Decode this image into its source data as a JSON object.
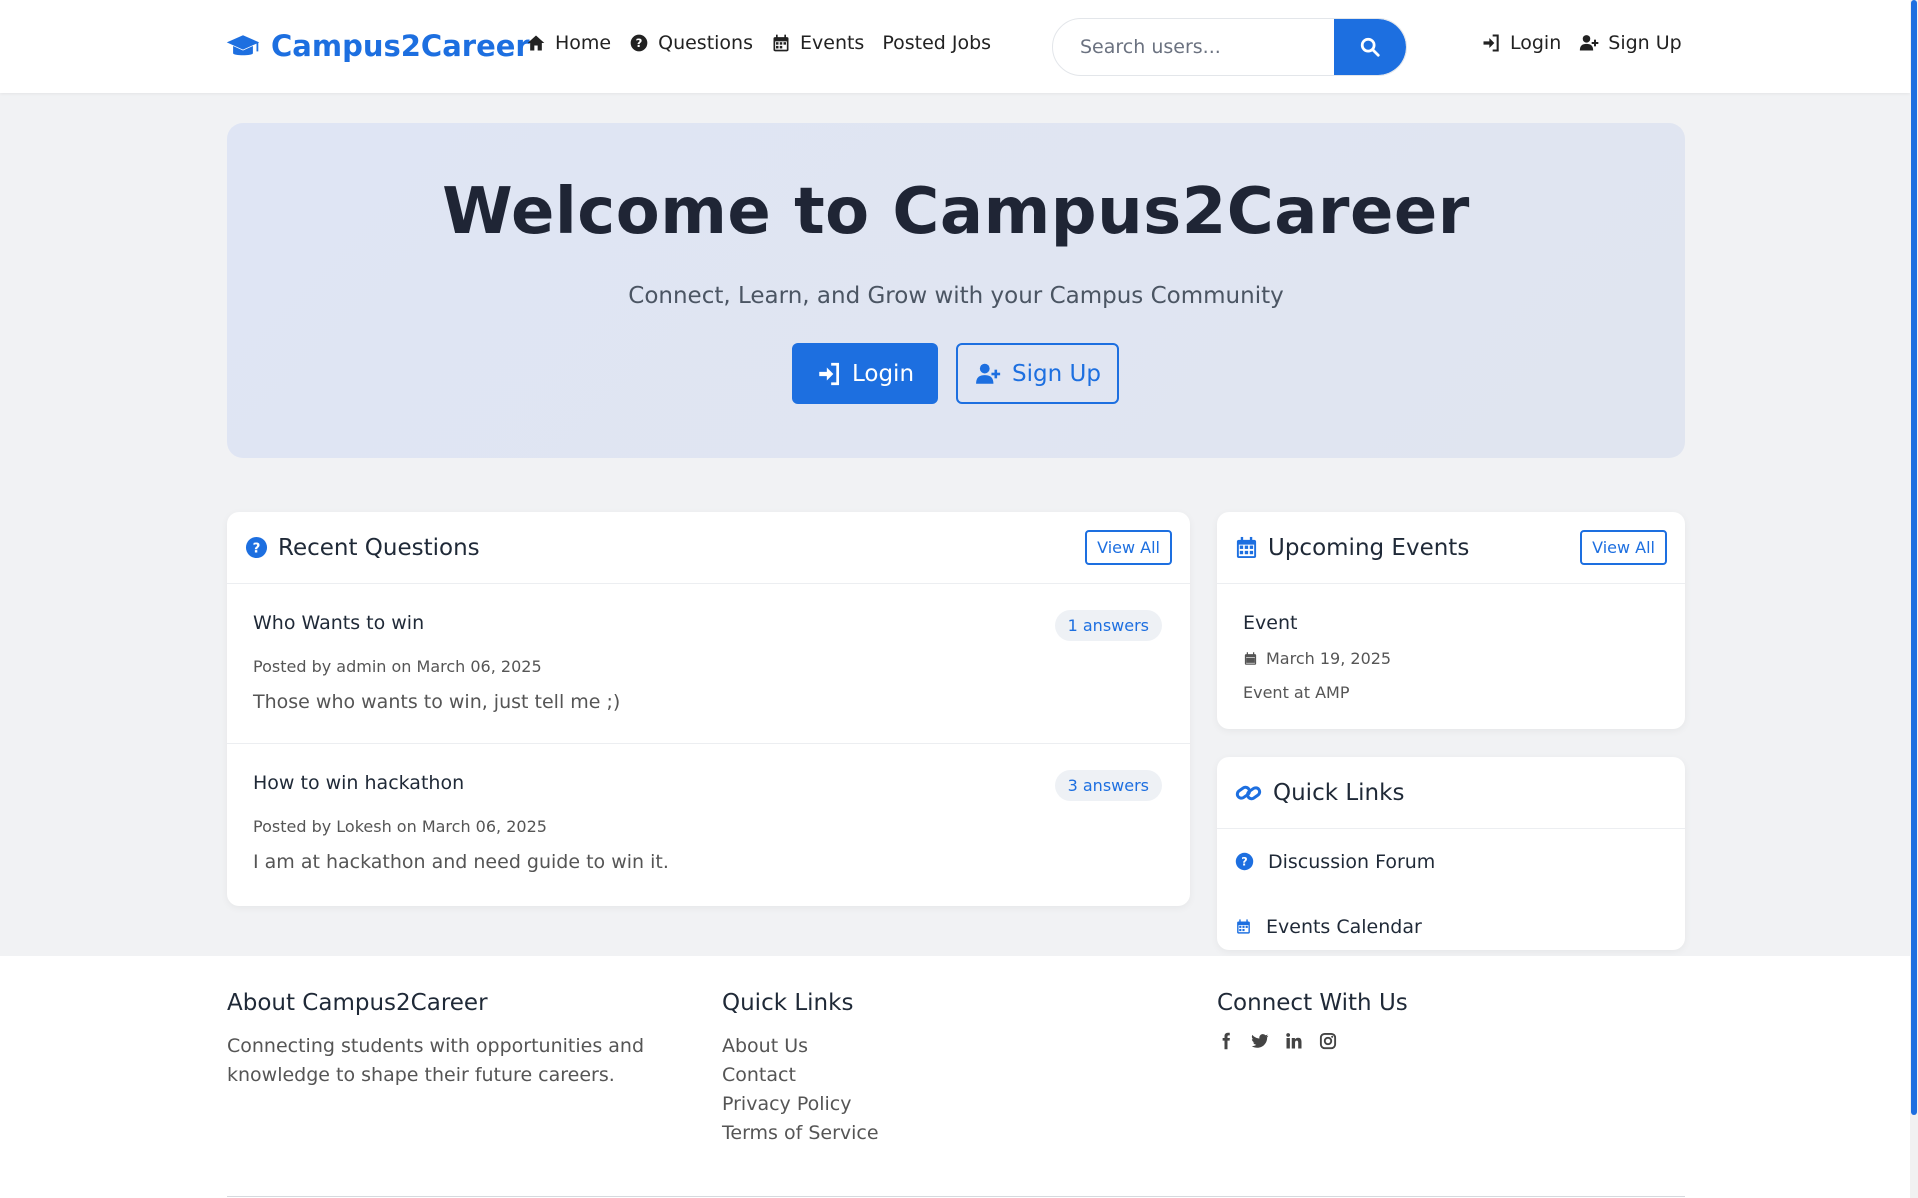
{
  "navbar": {
    "brand": "Campus2Career",
    "links": [
      "Home",
      "Questions",
      "Events",
      "Posted Jobs"
    ],
    "search_placeholder": "Search users...",
    "login": "Login",
    "signup": "Sign Up"
  },
  "hero": {
    "title": "Welcome to Campus2Career",
    "subtitle": "Connect, Learn, and Grow with your Campus Community",
    "login": "Login",
    "signup": "Sign Up"
  },
  "questions": {
    "title": "Recent Questions",
    "view_all": "View All",
    "items": [
      {
        "title": "Who Wants to win",
        "answers": "1 answers",
        "meta": "Posted by admin on March 06, 2025",
        "body": "Those who wants to win, just tell me ;)"
      },
      {
        "title": "How to win hackathon",
        "answers": "3 answers",
        "meta": "Posted by Lokesh on March 06, 2025",
        "body": "I am at hackathon and need guide to win it."
      }
    ]
  },
  "events": {
    "title": "Upcoming Events",
    "view_all": "View All",
    "item": {
      "title": "Event",
      "date": "March 19, 2025",
      "location": "Event at AMP"
    }
  },
  "quick_links_card": {
    "title": "Quick Links",
    "items": [
      "Discussion Forum",
      "Events Calendar"
    ]
  },
  "footer": {
    "about_title": "About Campus2Career",
    "about_text": "Connecting students with opportunities and knowledge to shape their future careers.",
    "links_title": "Quick Links",
    "links": [
      "About Us",
      "Contact",
      "Privacy Policy",
      "Terms of Service"
    ],
    "connect_title": "Connect With Us",
    "social_icons": [
      "facebook-icon",
      "twitter-icon",
      "linkedin-icon",
      "instagram-icon"
    ]
  },
  "colors": {
    "accent": "#1d6fe0",
    "page_background": "#f1f2f4",
    "hero_background": "#dfe5f4"
  }
}
